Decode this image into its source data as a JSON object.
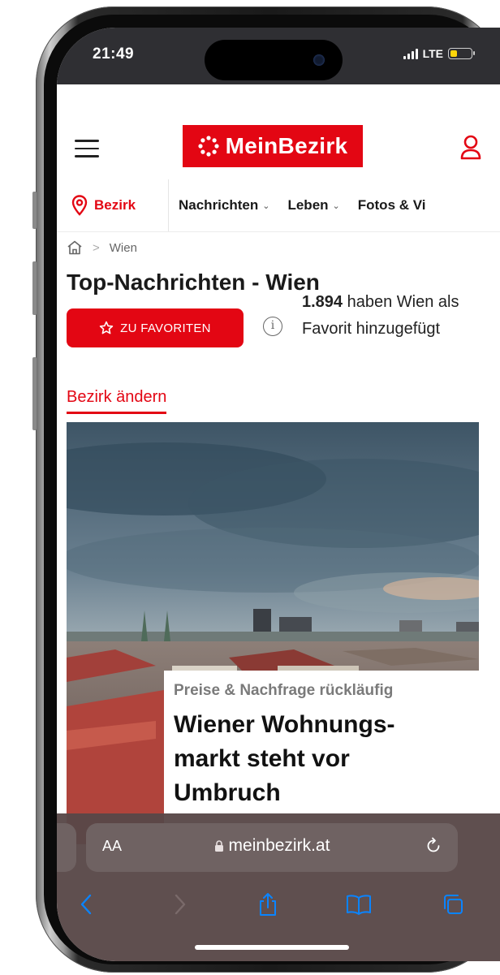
{
  "status_bar": {
    "time": "21:49",
    "network": "LTE",
    "battery_level": 0.35,
    "battery_color": "#ffd60a"
  },
  "header": {
    "logo_text": "MeinBezirk",
    "brand_color": "#e30613",
    "menu_icon": "hamburger-menu-icon",
    "account_icon": "user-account-icon"
  },
  "nav": {
    "location_label": "Bezirk",
    "items": [
      {
        "label": "Nachrichten",
        "has_dropdown": true
      },
      {
        "label": "Leben",
        "has_dropdown": true
      },
      {
        "label": "Fotos & Vi",
        "has_dropdown": false
      }
    ]
  },
  "breadcrumb": {
    "separator": ">",
    "current": "Wien"
  },
  "page": {
    "title": "Top-Nachrichten - Wien",
    "favorite_button_label": "ZU FAVORITEN",
    "favorite_count": "1.894",
    "favorite_text": "haben Wien als Favorit hinzugefügt",
    "change_bezirk_link": "Bezirk ändern"
  },
  "hero_article": {
    "kicker": "Preise & Nachfrage rückläufig",
    "headline": "Wiener Wohnungs-markt steht vor Umbruch"
  },
  "browser": {
    "aa_label": "AA",
    "url": "meinbezirk.at",
    "toolbar_icons": [
      "back-icon",
      "forward-icon",
      "share-icon",
      "bookmarks-icon",
      "tabs-icon"
    ]
  }
}
